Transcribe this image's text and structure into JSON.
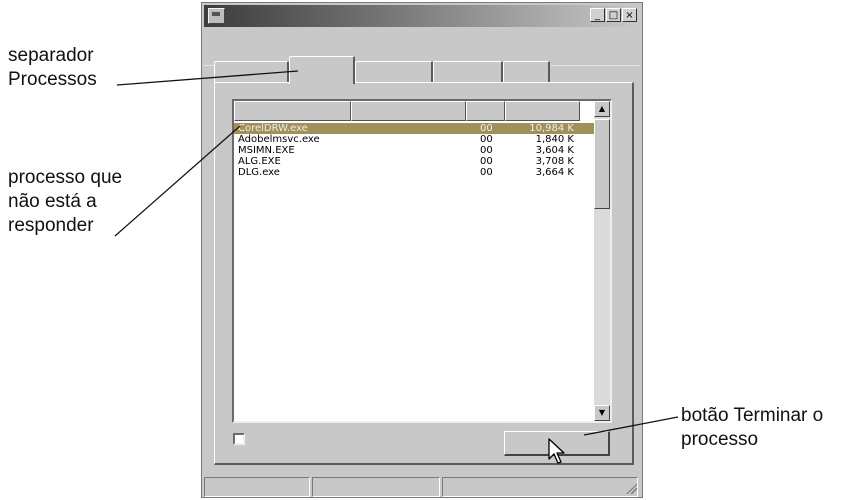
{
  "callouts": {
    "tab_label_line1": "separador",
    "tab_label_line2": "Processos",
    "process_label_line1": "processo que",
    "process_label_line2": "não está a",
    "process_label_line3": "responder",
    "button_label_line1": "botão Terminar o",
    "button_label_line2": "processo"
  },
  "window": {
    "buttons": {
      "minimize": "_",
      "maximize": "□",
      "close": "×"
    }
  },
  "processes": [
    {
      "name": "CorelDRW.exe",
      "cpu": "00",
      "mem": "10,984 K",
      "selected": true
    },
    {
      "name": "Adobelmsvc.exe",
      "cpu": "00",
      "mem": "1,840 K"
    },
    {
      "name": "MSIMN.EXE",
      "cpu": "00",
      "mem": "3,604 K"
    },
    {
      "name": "ALG.EXE",
      "cpu": "00",
      "mem": "3,708 K"
    },
    {
      "name": "DLG.exe",
      "cpu": "00",
      "mem": "3,664 K"
    }
  ],
  "scrollbar": {
    "up_icon": "▲",
    "down_icon": "▼"
  },
  "icons": [
    "system-menu-icon",
    "minimize-icon",
    "maximize-icon",
    "close-icon",
    "scroll-up-icon",
    "scroll-down-icon",
    "mouse-pointer-icon",
    "resize-grip-icon"
  ],
  "colors": {
    "selection": "#a0915a",
    "window": "#c8c8c8"
  }
}
